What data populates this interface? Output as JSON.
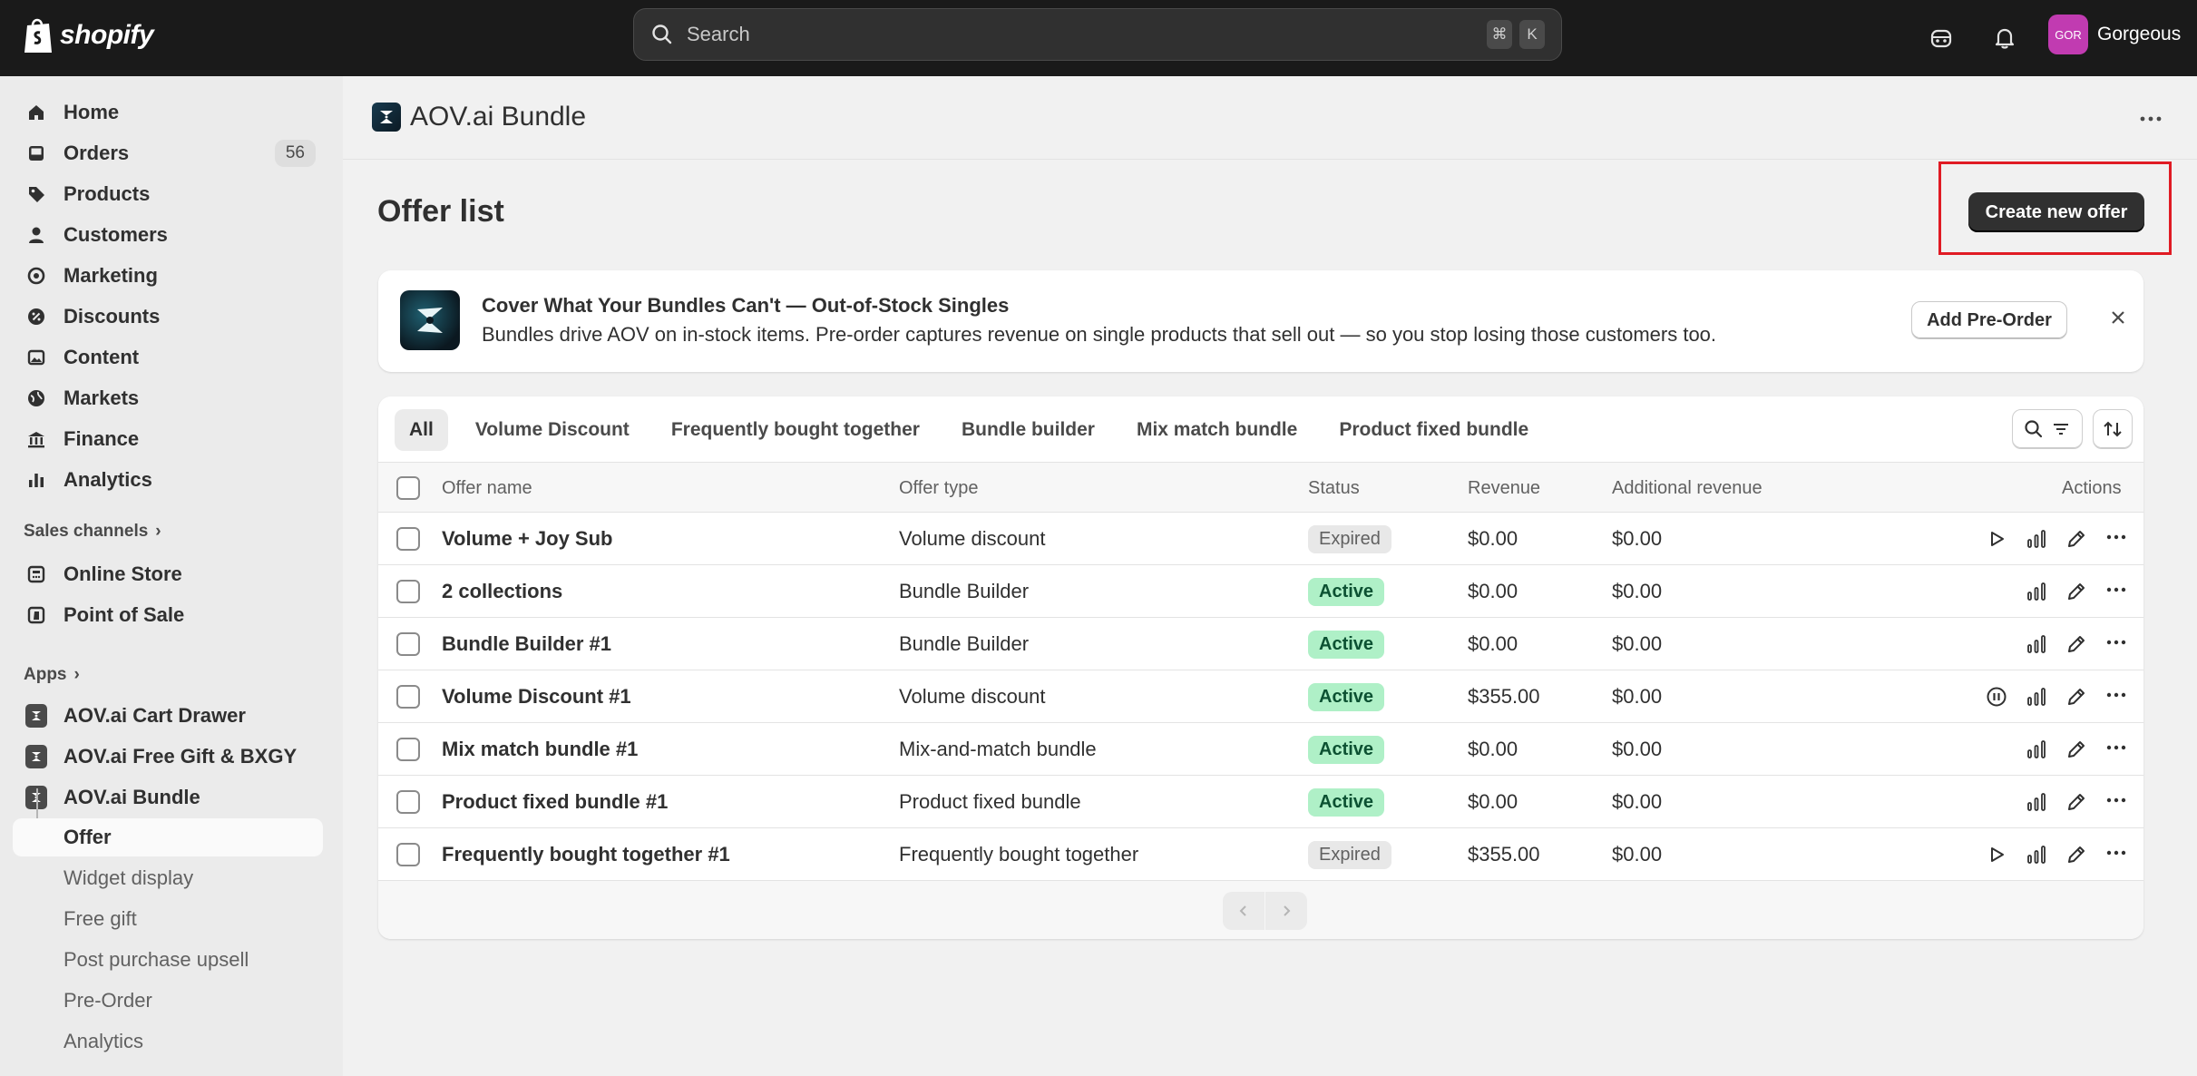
{
  "topbar": {
    "brand": "shopify",
    "search_placeholder": "Search",
    "kbd_cmd": "⌘",
    "kbd_k": "K",
    "avatar_initials": "GOR",
    "store_name": "Gorgeous",
    "avatar_color": "#c13bb1"
  },
  "sidebar": {
    "items": [
      {
        "label": "Home",
        "icon": "home-icon"
      },
      {
        "label": "Orders",
        "icon": "inbox-icon",
        "badge": "56"
      },
      {
        "label": "Products",
        "icon": "tag-icon"
      },
      {
        "label": "Customers",
        "icon": "person-icon"
      },
      {
        "label": "Marketing",
        "icon": "target-icon"
      },
      {
        "label": "Discounts",
        "icon": "discount-icon"
      },
      {
        "label": "Content",
        "icon": "image-icon"
      },
      {
        "label": "Markets",
        "icon": "globe-icon"
      },
      {
        "label": "Finance",
        "icon": "bank-icon"
      },
      {
        "label": "Analytics",
        "icon": "bar-chart-icon"
      }
    ],
    "sales_channels_label": "Sales channels",
    "channels": [
      {
        "label": "Online Store",
        "icon": "store-icon"
      },
      {
        "label": "Point of Sale",
        "icon": "pos-icon"
      }
    ],
    "apps_label": "Apps",
    "apps": [
      {
        "label": "AOV.ai Cart Drawer"
      },
      {
        "label": "AOV.ai Free Gift & BXGY"
      },
      {
        "label": "AOV.ai Bundle"
      }
    ],
    "sub_items": [
      {
        "label": "Offer",
        "active": true
      },
      {
        "label": "Widget display"
      },
      {
        "label": "Free gift"
      },
      {
        "label": "Post purchase upsell"
      },
      {
        "label": "Pre-Order"
      },
      {
        "label": "Analytics"
      }
    ]
  },
  "header": {
    "app_title": "AOV.ai Bundle"
  },
  "page": {
    "title": "Offer list",
    "create_button": "Create new offer"
  },
  "banner": {
    "title": "Cover What Your Bundles Can't — Out-of-Stock Singles",
    "text": "Bundles drive AOV on in-stock items. Pre-order captures revenue on single products that sell out — so you stop losing those customers too.",
    "button": "Add Pre-Order"
  },
  "tabs": [
    "All",
    "Volume Discount",
    "Frequently bought together",
    "Bundle builder",
    "Mix match bundle",
    "Product fixed bundle"
  ],
  "table": {
    "headers": {
      "name": "Offer name",
      "type": "Offer type",
      "status": "Status",
      "revenue": "Revenue",
      "additional": "Additional revenue",
      "actions": "Actions"
    },
    "rows": [
      {
        "name": "Volume + Joy Sub",
        "type": "Volume discount",
        "status": "Expired",
        "revenue": "$0.00",
        "additional": "$0.00",
        "state_icon": "play-icon"
      },
      {
        "name": "2 collections",
        "type": "Bundle Builder",
        "status": "Active",
        "revenue": "$0.00",
        "additional": "$0.00",
        "state_icon": ""
      },
      {
        "name": "Bundle Builder #1",
        "type": "Bundle Builder",
        "status": "Active",
        "revenue": "$0.00",
        "additional": "$0.00",
        "state_icon": ""
      },
      {
        "name": "Volume Discount #1",
        "type": "Volume discount",
        "status": "Active",
        "revenue": "$355.00",
        "additional": "$0.00",
        "state_icon": "pause-icon"
      },
      {
        "name": "Mix match bundle #1",
        "type": "Mix-and-match bundle",
        "status": "Active",
        "revenue": "$0.00",
        "additional": "$0.00",
        "state_icon": ""
      },
      {
        "name": "Product fixed bundle #1",
        "type": "Product fixed bundle",
        "status": "Active",
        "revenue": "$0.00",
        "additional": "$0.00",
        "state_icon": ""
      },
      {
        "name": "Frequently bought together #1",
        "type": "Frequently bought together",
        "status": "Expired",
        "revenue": "$355.00",
        "additional": "$0.00",
        "state_icon": "play-icon"
      }
    ]
  },
  "colors": {
    "active_badge_bg": "#aff0c7",
    "expired_badge_bg": "#e8e8e8",
    "highlight": "#e01b24"
  }
}
